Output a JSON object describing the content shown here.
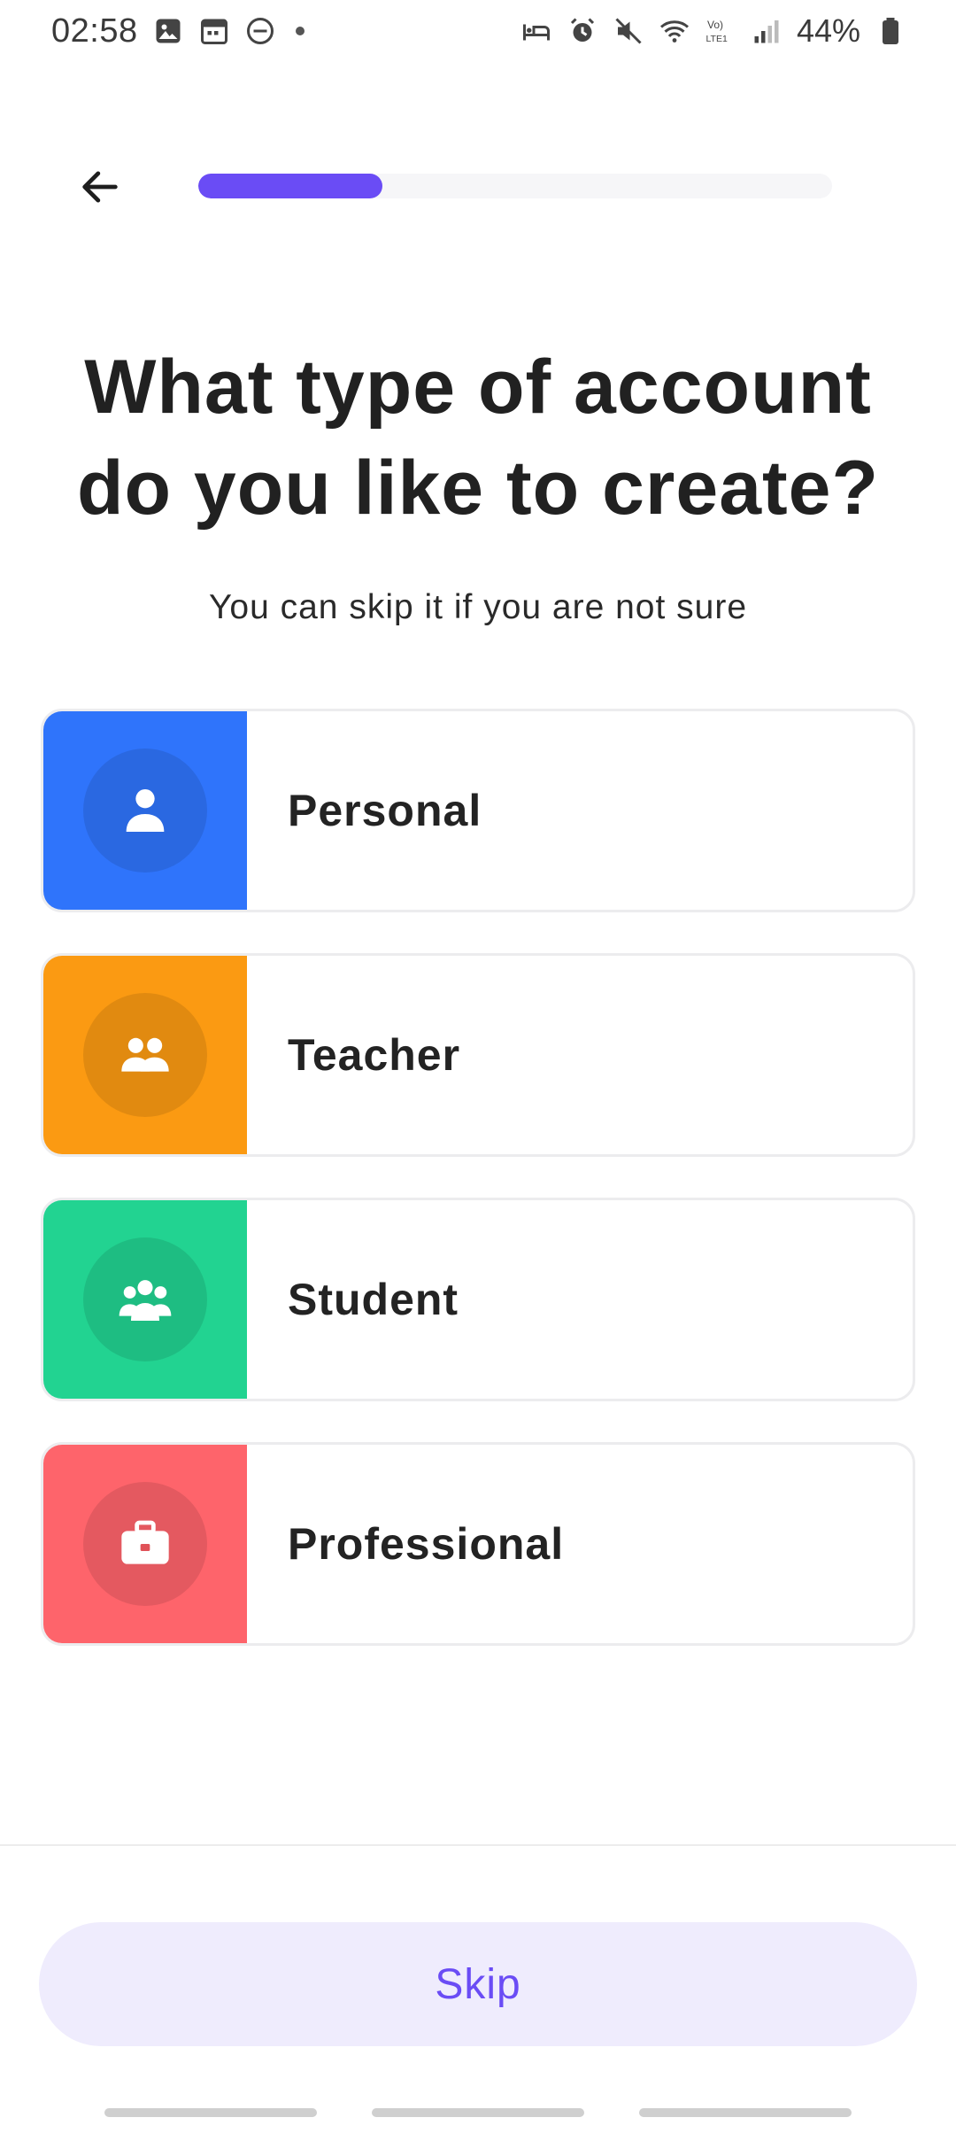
{
  "status_bar": {
    "time": "02:58",
    "battery": "44%",
    "left_icons": [
      "image-icon",
      "calendar-icon",
      "do-not-disturb-icon"
    ],
    "right_icons": [
      "bed-icon",
      "alarm-icon",
      "mute-icon",
      "wifi-icon",
      "volte-icon",
      "signal-icon",
      "battery-icon"
    ],
    "network_label": "Vo) LTE1"
  },
  "header": {
    "back_icon": "arrow-left-icon",
    "progress_fraction": 0.29,
    "accent": "#6a4cf5"
  },
  "main": {
    "title": "What type of account do you like to create?",
    "subtitle": "You can skip it if you are not sure",
    "options": [
      {
        "label": "Personal",
        "icon": "person-icon",
        "color": "#2f74fb"
      },
      {
        "label": "Teacher",
        "icon": "group-icon",
        "color": "#fb9a12"
      },
      {
        "label": "Student",
        "icon": "users-icon",
        "color": "#22d391"
      },
      {
        "label": "Professional",
        "icon": "briefcase-icon",
        "color": "#fe646b"
      }
    ]
  },
  "footer": {
    "skip_label": "Skip"
  }
}
